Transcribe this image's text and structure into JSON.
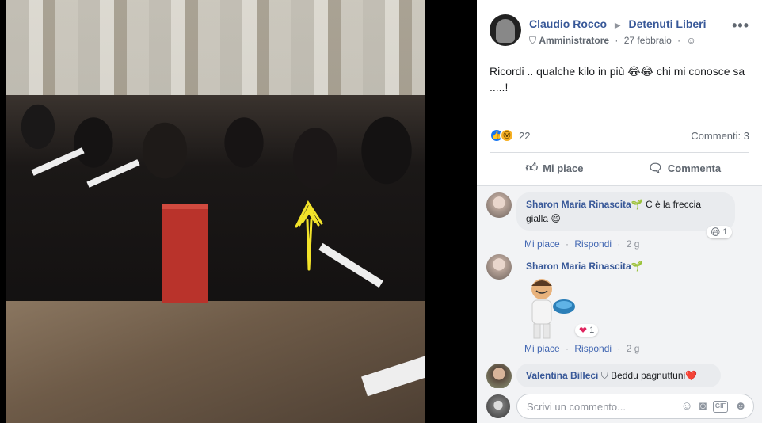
{
  "post": {
    "author": "Claudio Rocco",
    "group": "Detenuti Liberi",
    "role": "Amministratore",
    "date": "27 febbraio",
    "text": "Ricordi .. qualche kilo in più 😂😂 chi mi conosce sa .....!",
    "reactions_count": "22",
    "comments_count": "Commenti: 3",
    "more": "•••"
  },
  "actions": {
    "like": "Mi piace",
    "comment": "Commenta"
  },
  "comments": [
    {
      "author": "Sharon Maria Rinascita🌱",
      "text": "C è la freccia gialla 😄",
      "like": "Mi piace",
      "reply": "Rispondi",
      "time": "2 g",
      "reaction_count": "1"
    },
    {
      "author": "Sharon Maria Rinascita🌱",
      "like": "Mi piace",
      "reply": "Rispondi",
      "time": "2 g",
      "reaction_count": "1"
    },
    {
      "author": "Valentina Billeci",
      "text": "Beddu pagnuttuni❤️"
    }
  ],
  "composer": {
    "placeholder": "Scrivi un commento..."
  }
}
